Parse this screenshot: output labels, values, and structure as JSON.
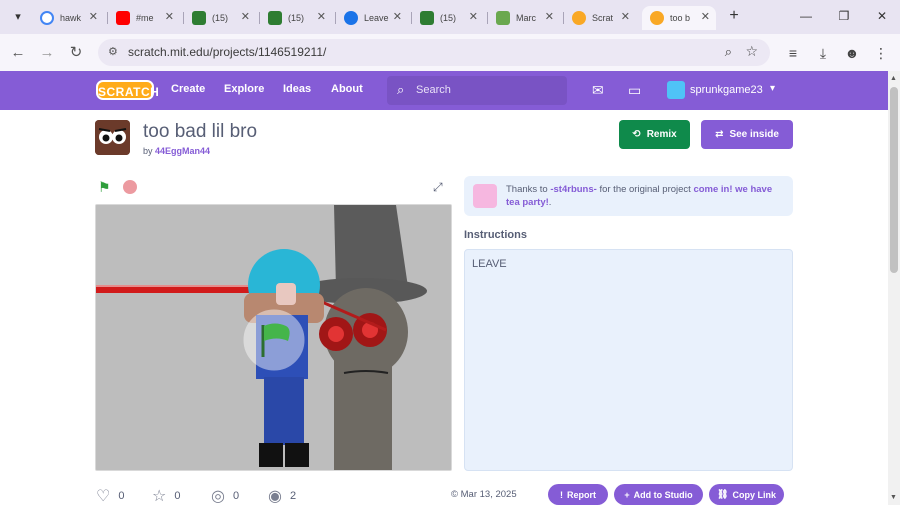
{
  "browser": {
    "tabs": [
      {
        "title": "hawk",
        "color": "#4285f4",
        "icon": "google-icon"
      },
      {
        "title": "#me",
        "color": "#ff0000",
        "icon": "youtube-icon"
      },
      {
        "title": "(15)",
        "color": "#2e7d32",
        "icon": "ne-icon"
      },
      {
        "title": "(15)",
        "color": "#2e7d32",
        "icon": "ne-icon"
      },
      {
        "title": "Leave",
        "color": "#1a73e8",
        "icon": "steam-icon"
      },
      {
        "title": "(15)",
        "color": "#2e7d32",
        "icon": "ne-icon"
      },
      {
        "title": "Marc",
        "color": "#6aa84f",
        "icon": "image-icon"
      },
      {
        "title": "Scrat",
        "color": "#f9a825",
        "icon": "scratch-icon"
      },
      {
        "title": "too b",
        "color": "#f9a825",
        "icon": "scratch-icon",
        "active": true
      }
    ],
    "url": "scratch.mit.edu/projects/1146519211/"
  },
  "nav": {
    "logo": "SCRATCH",
    "create": "Create",
    "explore": "Explore",
    "ideas": "Ideas",
    "about": "About",
    "search_placeholder": "Search",
    "username": "sprunkgame23"
  },
  "project": {
    "title": "too bad lil bro",
    "by_prefix": "by",
    "author": "44EggMan44",
    "remix_label": "Remix",
    "see_inside_label": "See inside"
  },
  "credits": {
    "prefix": "Thanks to",
    "user": "-st4rbuns-",
    "middle": "for the original project",
    "original": "come in! we have tea party!",
    "suffix": "."
  },
  "instructions": {
    "heading": "Instructions",
    "text": "LEAVE"
  },
  "stats": {
    "loves": "0",
    "favorites": "0",
    "remixes": "0",
    "views": "2",
    "date": "Mar 13, 2025"
  },
  "actions": {
    "report": "Report",
    "add_to_studio": "Add to Studio",
    "copy_link": "Copy Link"
  },
  "colors": {
    "scratch_purple": "#855cd6",
    "remix_green": "#0f8a4b",
    "logo_orange": "#ffab19"
  }
}
